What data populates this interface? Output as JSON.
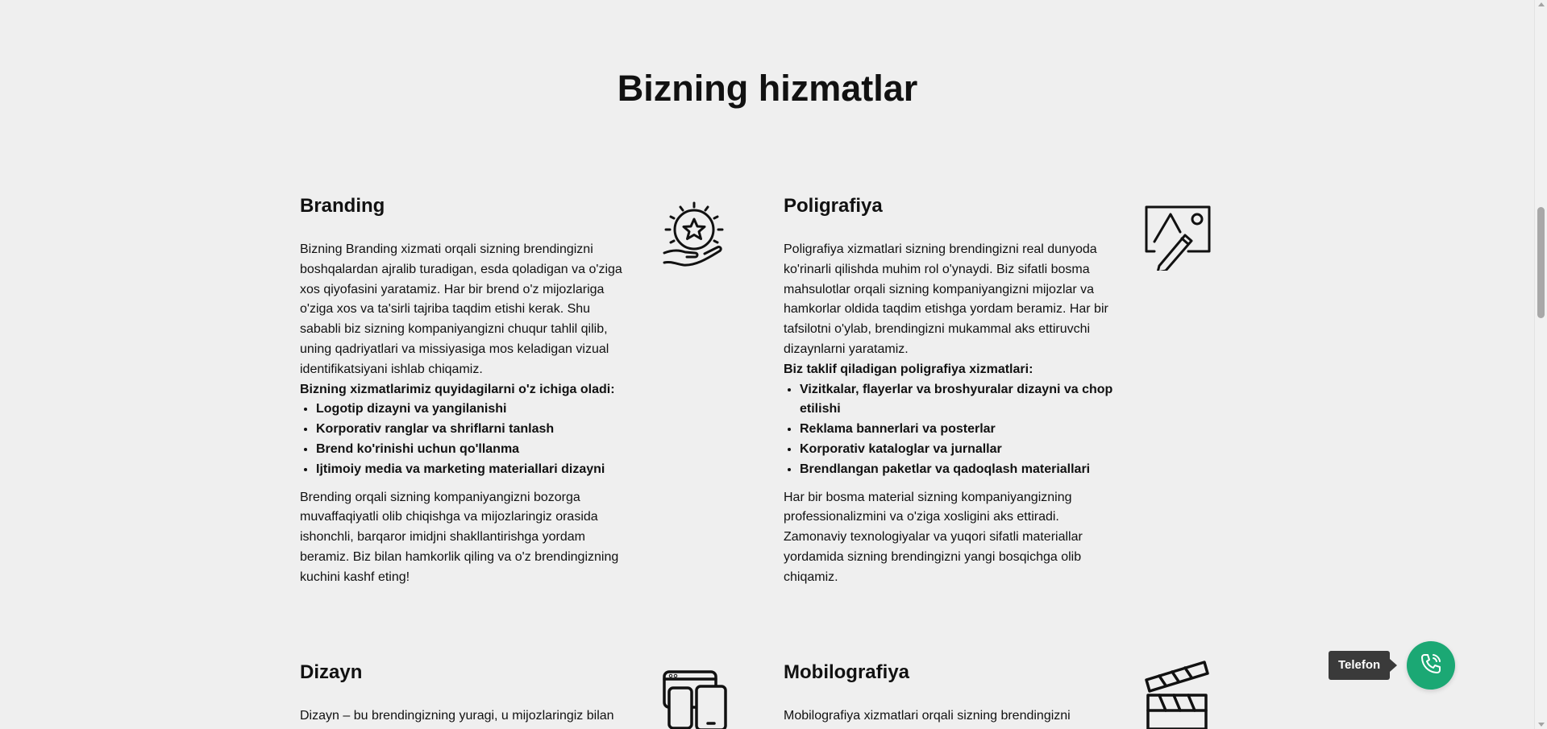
{
  "section": {
    "title": "Bizning hizmatlar"
  },
  "services": {
    "branding": {
      "title": "Branding",
      "icon": "hand-star-icon",
      "intro": "Bizning Branding xizmati orqali sizning brendingizni boshqalardan ajralib turadigan, esda qoladigan va o'ziga xos qiyofasini yaratamiz. Har bir brend o'z mijozlariga o'ziga xos va ta'sirli tajriba taqdim etishi kerak. Shu sababli biz sizning kompaniyangizni chuqur tahlil qilib, uning qadriyatlari va missiyasiga mos keladigan vizual identifikatsiyani ishlab chiqamiz.",
      "lead": "Bizning xizmatlarimiz quyidagilarni o'z ichiga oladi:",
      "items": [
        "Logotip dizayni va yangilanishi",
        "Korporativ ranglar va shriflarni tanlash",
        "Brend ko'rinishi uchun qo'llanma",
        "Ijtimoiy media va marketing materiallari dizayni"
      ],
      "outro": "Brending orqali sizning kompaniyangizni bozorga muvaffaqiyatli olib chiqishga va mijozlaringiz orasida ishonchli, barqaror imidjni shakllantirishga yordam beramiz. Biz bilan hamkorlik qiling va o'z brendingizning kuchini kashf eting!"
    },
    "poligrafiya": {
      "title": "Poligrafiya",
      "icon": "image-pencil-icon",
      "intro": "Poligrafiya xizmatlari sizning brendingizni real dunyoda ko'rinarli qilishda muhim rol o'ynaydi. Biz sifatli bosma mahsulotlar orqali sizning kompaniyangizni mijozlar va hamkorlar oldida taqdim etishga yordam beramiz. Har bir tafsilotni o'ylab, brendingizni mukammal aks ettiruvchi dizaynlarni yaratamiz.",
      "lead": "Biz taklif qiladigan poligrafiya xizmatlari:",
      "items": [
        "Vizitkalar, flayerlar va broshyuralar dizayni va chop etilishi",
        "Reklama bannerlari va posterlar",
        "Korporativ kataloglar va jurnallar",
        "Brendlangan paketlar va qadoqlash materiallari"
      ],
      "outro": "Har bir bosma material sizning kompaniyangizning professionalizmini va o'ziga xosligini aks ettiradi. Zamonaviy texnologiyalar va yuqori sifatli materiallar yordamida sizning brendingizni yangi bosqichga olib chiqamiz."
    },
    "dizayn": {
      "title": "Dizayn",
      "icon": "devices-icon",
      "intro": "Dizayn – bu brendingizning yuragi, u mijozlaringiz bilan"
    },
    "mobilografiya": {
      "title": "Mobilografiya",
      "icon": "clapperboard-icon",
      "intro": "Mobilografiya xizmatlari orqali sizning brendingizni"
    }
  },
  "phone_widget": {
    "label": "Telefon",
    "icon": "phone-call-icon",
    "color": "#1ba874"
  }
}
